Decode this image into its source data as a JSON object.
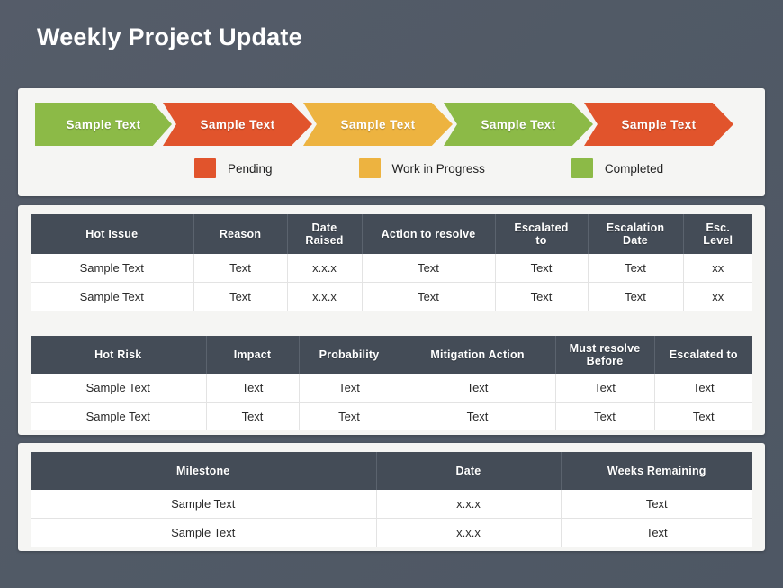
{
  "page": {
    "title": "Weekly Project Update"
  },
  "colors": {
    "pending": "#E1542C",
    "work_in_progress": "#EDB340",
    "completed": "#8CBA47",
    "header_dark": "#444C57",
    "background": "#525A67",
    "panel": "#F5F5F3"
  },
  "process": {
    "steps": [
      {
        "label": "Sample Text",
        "status": "completed",
        "color": "#8CBA47"
      },
      {
        "label": "Sample Text",
        "status": "pending",
        "color": "#E1542C"
      },
      {
        "label": "Sample Text",
        "status": "work_in_progress",
        "color": "#EDB340"
      },
      {
        "label": "Sample Text",
        "status": "completed",
        "color": "#8CBA47"
      },
      {
        "label": "Sample Text",
        "status": "pending",
        "color": "#E1542C"
      }
    ],
    "legend": [
      {
        "label": "Pending",
        "color": "#E1542C"
      },
      {
        "label": "Work in Progress",
        "color": "#EDB340"
      },
      {
        "label": "Completed",
        "color": "#8CBA47"
      }
    ]
  },
  "tables": {
    "issues": {
      "headers": [
        "Hot Issue",
        "Reason",
        "Date\nRaised",
        "Action to resolve",
        "Escalated\nto",
        "Escalation\nDate",
        "Esc.\nLevel"
      ],
      "rows": [
        [
          "Sample Text",
          "Text",
          "x.x.x",
          "Text",
          "Text",
          "Text",
          "xx"
        ],
        [
          "Sample Text",
          "Text",
          "x.x.x",
          "Text",
          "Text",
          "Text",
          "xx"
        ]
      ]
    },
    "risks": {
      "headers": [
        "Hot Risk",
        "Impact",
        "Probability",
        "Mitigation Action",
        "Must resolve\nBefore",
        "Escalated to"
      ],
      "rows": [
        [
          "Sample Text",
          "Text",
          "Text",
          "Text",
          "Text",
          "Text"
        ],
        [
          "Sample Text",
          "Text",
          "Text",
          "Text",
          "Text",
          "Text"
        ]
      ]
    },
    "milestones": {
      "headers": [
        "Milestone",
        "Date",
        "Weeks Remaining"
      ],
      "rows": [
        [
          "Sample Text",
          "x.x.x",
          "Text"
        ],
        [
          "Sample Text",
          "x.x.x",
          "Text"
        ]
      ]
    }
  }
}
